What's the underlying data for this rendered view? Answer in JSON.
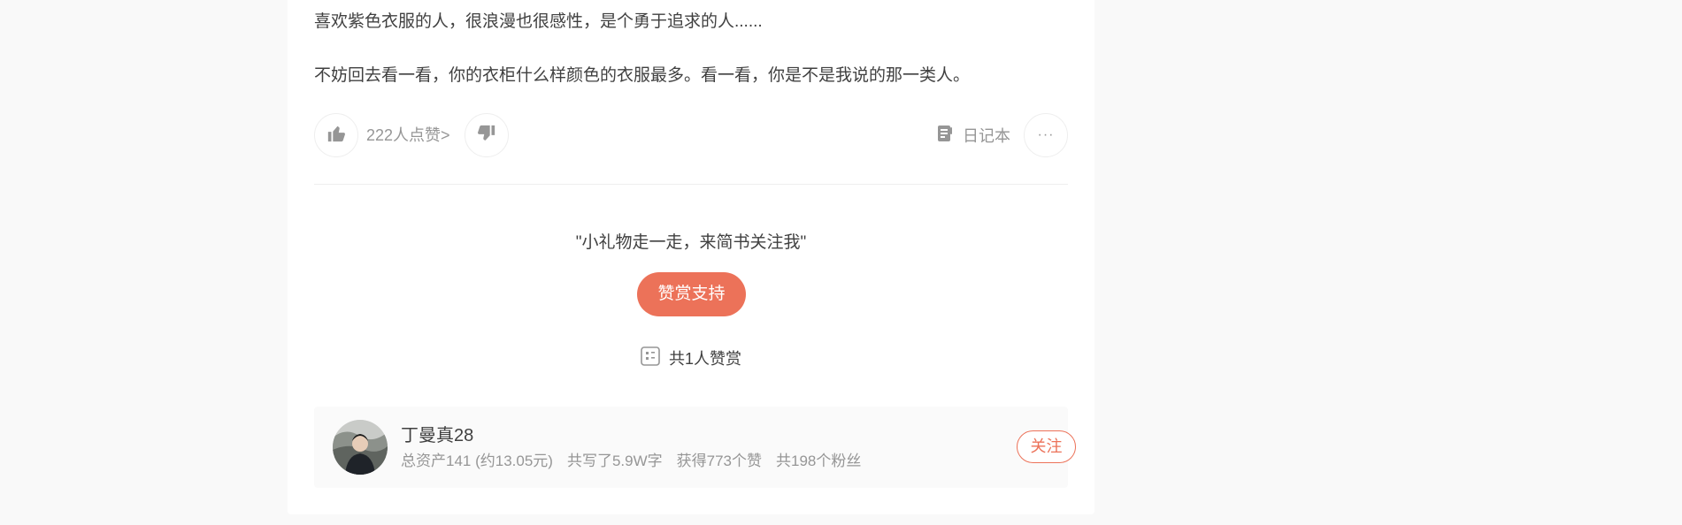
{
  "article": {
    "paragraphs": [
      "喜欢紫色衣服的人，很浪漫也很感性，是个勇于追求的人......",
      "不妨回去看一看，你的衣柜什么样颜色的衣服最多。看一看，你是不是我说的那一类人。"
    ]
  },
  "actions": {
    "like_count": "222人点赞",
    "like_chevron": ">",
    "notebook_label": "日记本",
    "more_label": "···"
  },
  "reward": {
    "quote": "\"小礼物走一走，来简书关注我\"",
    "button_label": "赞赏支持",
    "count_text": "共1人赞赏"
  },
  "author": {
    "name": "丁曼真28",
    "stats": [
      "总资产141 (约13.05元)",
      "共写了5.9W字",
      "获得773个赞",
      "共198个粉丝"
    ],
    "follow_label": "关注"
  },
  "colors": {
    "accent": "#ec7259",
    "muted": "#969696",
    "text": "#404040",
    "page_bg": "#f9f9f9"
  },
  "icons": [
    "thumbs-up-icon",
    "thumbs-down-icon",
    "notebook-icon",
    "more-icon",
    "reward-list-icon"
  ]
}
